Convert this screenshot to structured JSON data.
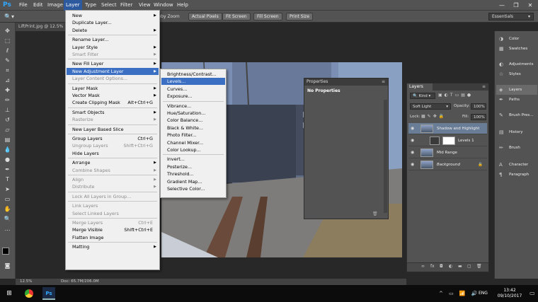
{
  "app": {
    "logo": "Ps",
    "document_tab": "LiftPrint.jpg @ 12.5%"
  },
  "menubar": [
    "File",
    "Edit",
    "Image",
    "Layer",
    "Type",
    "Select",
    "Filter",
    "View",
    "Window",
    "Help"
  ],
  "window_controls": {
    "minimize": "—",
    "restore": "❐",
    "close": "✕"
  },
  "options_bar": {
    "scrubby_zoom": "Scrubby Zoom",
    "buttons": [
      "Actual Pixels",
      "Fit Screen",
      "Fill Screen",
      "Print Size"
    ],
    "workspace": "Essentials"
  },
  "layer_menu": [
    {
      "label": "New",
      "arrow": true
    },
    {
      "label": "Duplicate Layer..."
    },
    {
      "label": "Delete",
      "arrow": true
    },
    {
      "sep": true
    },
    {
      "label": "Rename Layer..."
    },
    {
      "label": "Layer Style",
      "arrow": true
    },
    {
      "label": "Smart Filter",
      "disabled": true,
      "arrow": true
    },
    {
      "sep": true
    },
    {
      "label": "New Fill Layer",
      "arrow": true
    },
    {
      "label": "New Adjustment Layer",
      "arrow": true,
      "highlight": true
    },
    {
      "label": "Layer Content Options...",
      "disabled": true
    },
    {
      "sep": true
    },
    {
      "label": "Layer Mask",
      "arrow": true
    },
    {
      "label": "Vector Mask",
      "arrow": true
    },
    {
      "label": "Create Clipping Mask",
      "shortcut": "Alt+Ctrl+G"
    },
    {
      "sep": true
    },
    {
      "label": "Smart Objects",
      "arrow": true
    },
    {
      "label": "Rasterize",
      "disabled": true,
      "arrow": true
    },
    {
      "sep": true
    },
    {
      "label": "New Layer Based Slice"
    },
    {
      "sep": true
    },
    {
      "label": "Group Layers",
      "shortcut": "Ctrl+G"
    },
    {
      "label": "Ungroup Layers",
      "disabled": true,
      "shortcut": "Shift+Ctrl+G"
    },
    {
      "label": "Hide Layers"
    },
    {
      "sep": true
    },
    {
      "label": "Arrange",
      "arrow": true
    },
    {
      "label": "Combine Shapes",
      "disabled": true,
      "arrow": true
    },
    {
      "sep": true
    },
    {
      "label": "Align",
      "disabled": true,
      "arrow": true
    },
    {
      "label": "Distribute",
      "disabled": true,
      "arrow": true
    },
    {
      "sep": true
    },
    {
      "label": "Lock All Layers in Group...",
      "disabled": true
    },
    {
      "sep": true
    },
    {
      "label": "Link Layers",
      "disabled": true
    },
    {
      "label": "Select Linked Layers",
      "disabled": true
    },
    {
      "sep": true
    },
    {
      "label": "Merge Layers",
      "disabled": true,
      "shortcut": "Ctrl+E"
    },
    {
      "label": "Merge Visible",
      "shortcut": "Shift+Ctrl+E"
    },
    {
      "label": "Flatten Image"
    },
    {
      "sep": true
    },
    {
      "label": "Matting",
      "arrow": true
    }
  ],
  "adjustment_submenu": [
    {
      "label": "Brightness/Contrast..."
    },
    {
      "label": "Levels...",
      "highlight": true
    },
    {
      "label": "Curves..."
    },
    {
      "label": "Exposure..."
    },
    {
      "sep": true
    },
    {
      "label": "Vibrance..."
    },
    {
      "label": "Hue/Saturation..."
    },
    {
      "label": "Color Balance..."
    },
    {
      "label": "Black & White..."
    },
    {
      "label": "Photo Filter..."
    },
    {
      "label": "Channel Mixer..."
    },
    {
      "label": "Color Lookup..."
    },
    {
      "sep": true
    },
    {
      "label": "Invert..."
    },
    {
      "label": "Posterize..."
    },
    {
      "label": "Threshold..."
    },
    {
      "label": "Gradient Map..."
    },
    {
      "label": "Selective Color..."
    }
  ],
  "properties_panel": {
    "tab": "Properties",
    "content": "No Properties"
  },
  "layers_panel": {
    "tab": "Layers",
    "filter": "Kind",
    "blend_mode": "Soft Light",
    "opacity_label": "Opacity:",
    "opacity": "100%",
    "lock_label": "Lock:",
    "fill_label": "Fill:",
    "fill": "100%",
    "layers": [
      {
        "name": "Shadow and Highlight",
        "selected": true
      },
      {
        "name": "Levels 1"
      },
      {
        "name": "Mid Range"
      },
      {
        "name": "Background"
      }
    ],
    "footer_icons": [
      "link-icon",
      "fx-icon",
      "mask-icon",
      "adjustment-icon",
      "folder-icon",
      "new-layer-icon",
      "trash-icon"
    ],
    "footer_glyphs": [
      "∞",
      "fx",
      "◘",
      "◐",
      "▬",
      "▢",
      "🗑"
    ]
  },
  "side_panels": [
    "Color",
    "Swatches",
    "Adjustments",
    "Styles",
    "Layers",
    "Paths",
    "Brush Pres...",
    "History",
    "Brush",
    "Character",
    "Paragraph"
  ],
  "status_bar": {
    "zoom": "12.5%",
    "doc": "Doc: 65.7M/206.0M"
  },
  "taskbar": {
    "language": "ENG",
    "time": "13:42",
    "date": "09/10/2017"
  }
}
